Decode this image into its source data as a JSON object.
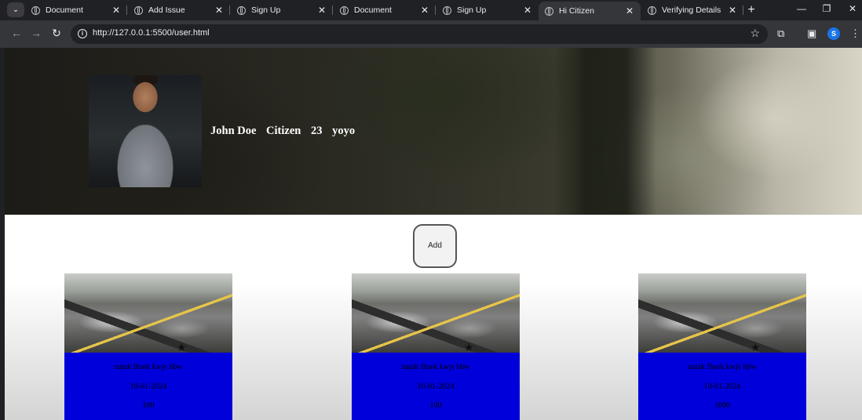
{
  "browser": {
    "tabs": [
      {
        "title": "Document",
        "active": false
      },
      {
        "title": "Add Issue",
        "active": false
      },
      {
        "title": "Sign Up",
        "active": false
      },
      {
        "title": "Document",
        "active": false
      },
      {
        "title": "Sign Up",
        "active": false
      },
      {
        "title": "Hi Citizen",
        "active": true
      },
      {
        "title": "Verifying Details",
        "active": false
      }
    ],
    "url": "http://127.0.0.1:5500/user.html",
    "profile_initial": "S"
  },
  "profile": {
    "name": "John Doe",
    "role": "Citizen",
    "age": "23",
    "note": "yoyo"
  },
  "add_button": {
    "label": "Add"
  },
  "cards": [
    {
      "title": "natak fhsek kwjs hbw",
      "date": "10-01-2024",
      "value": "100"
    },
    {
      "title": "natak fhsek kwjs hbw",
      "date": "10-01-2024",
      "value": "100"
    },
    {
      "title": "natak fhsek kwjs hbw",
      "date": "10-01-2024",
      "value": "1000"
    }
  ],
  "colors": {
    "card_body": "#0000db",
    "chrome_dark": "#202124",
    "chrome_toolbar": "#35363a"
  }
}
